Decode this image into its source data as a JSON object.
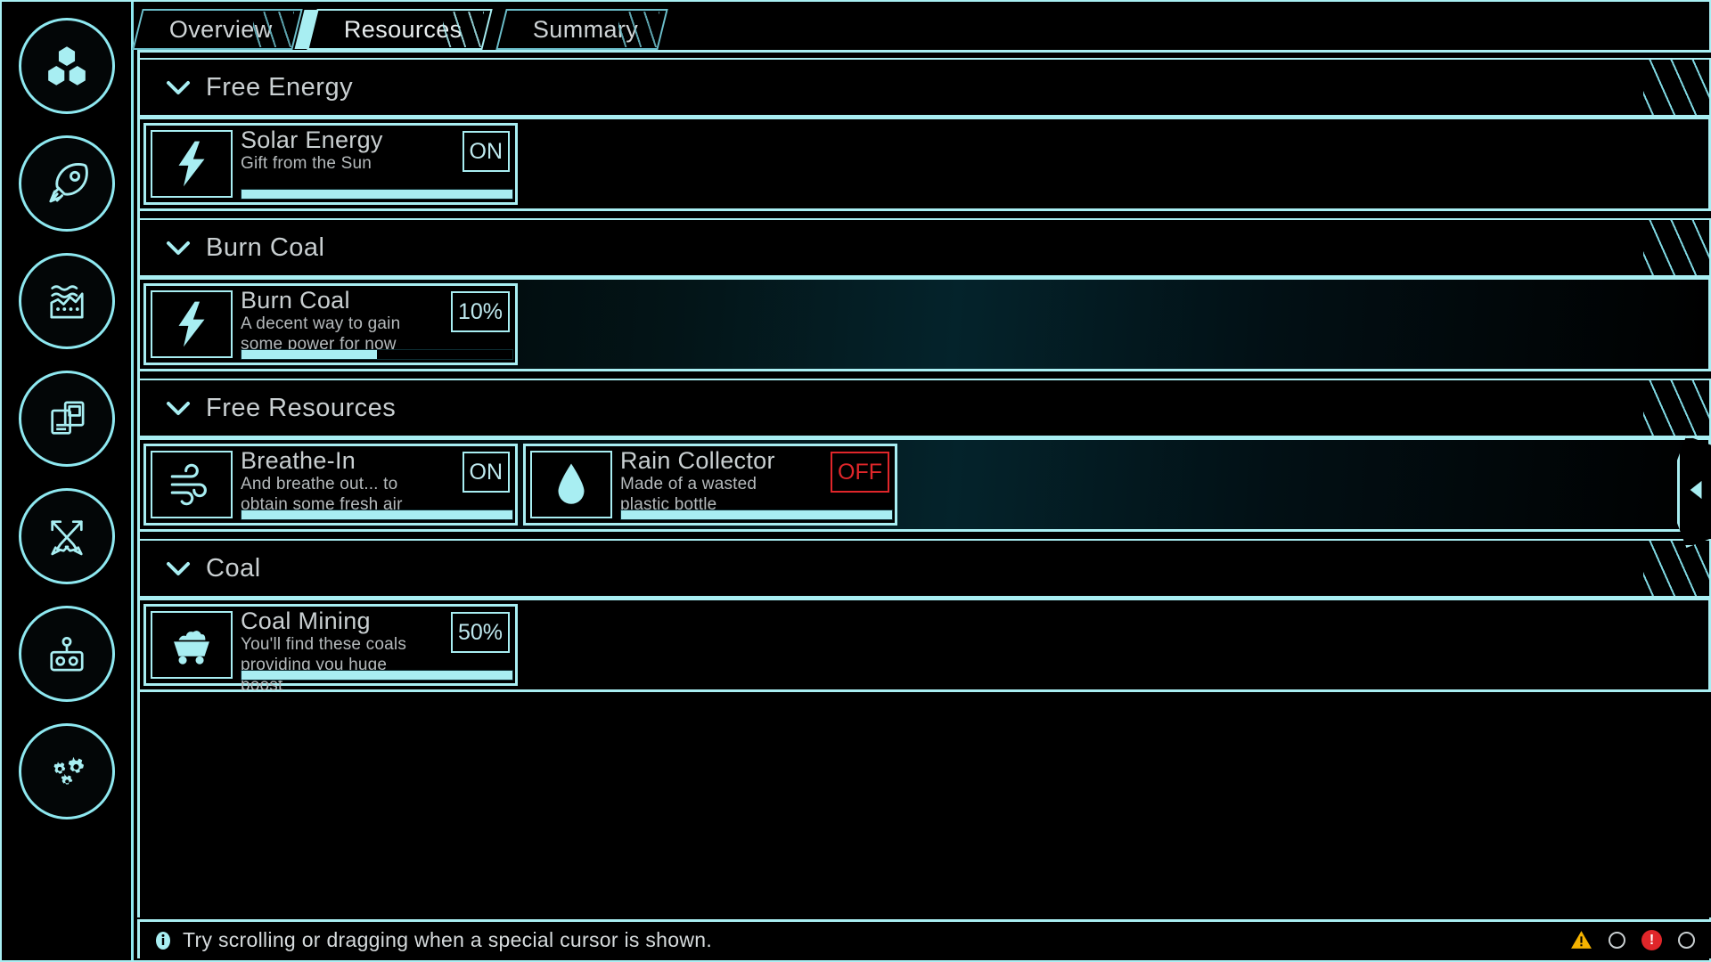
{
  "sidebar": {
    "items": [
      {
        "label": "Resources",
        "icon": "hex-cluster-icon"
      },
      {
        "label": "Rocket",
        "icon": "rocket-icon"
      },
      {
        "label": "Factory",
        "icon": "factory-icon"
      },
      {
        "label": "Cards",
        "icon": "cards-icon"
      },
      {
        "label": "Combat",
        "icon": "crossed-swords-icon"
      },
      {
        "label": "Robot",
        "icon": "robot-icon"
      },
      {
        "label": "Settings",
        "icon": "gears-icon"
      }
    ]
  },
  "tabs": [
    {
      "label": "Overview",
      "active": false
    },
    {
      "label": "Resources",
      "active": true
    },
    {
      "label": "Summary",
      "active": false
    }
  ],
  "sections": [
    {
      "title": "Free Energy",
      "chevron": "chevron-down-icon",
      "highlight": false,
      "cards": [
        {
          "name": "Solar Energy",
          "desc": "Gift from the Sun",
          "icon": "lightning-bolt-icon",
          "badge": "ON",
          "badge_state": "on",
          "progress": 100
        }
      ]
    },
    {
      "title": "Burn Coal",
      "chevron": "chevron-down-icon",
      "highlight": true,
      "cards": [
        {
          "name": "Burn Coal",
          "desc": "A decent way to gain some power for now",
          "icon": "lightning-bolt-icon",
          "badge": "10%",
          "badge_state": "on",
          "progress": 50
        }
      ]
    },
    {
      "title": "Free Resources",
      "chevron": "chevron-down-icon",
      "highlight": true,
      "cards": [
        {
          "name": "Breathe-In",
          "desc": "And breathe out... to obtain some fresh air",
          "icon": "wind-icon",
          "badge": "ON",
          "badge_state": "on",
          "progress": 100
        },
        {
          "name": "Rain Collector",
          "desc": "Made of a wasted plastic bottle",
          "icon": "water-drop-icon",
          "badge": "OFF",
          "badge_state": "off",
          "progress": 100
        }
      ]
    },
    {
      "title": "Coal",
      "chevron": "chevron-down-icon",
      "highlight": false,
      "cards": [
        {
          "name": "Coal Mining",
          "desc": "You'll find these coals providing you huge boost",
          "icon": "mine-cart-icon",
          "badge": "50%",
          "badge_state": "on",
          "progress": 100
        }
      ]
    }
  ],
  "side_arrow": {
    "icon": "chevron-left-icon"
  },
  "statusbar": {
    "info_icon": "info-icon",
    "text": "Try scrolling or dragging when a special cursor is shown.",
    "indicators": [
      {
        "name": "warning",
        "icon": "warning-triangle-icon"
      },
      {
        "name": "circle-1",
        "icon": "circle-outline-icon"
      },
      {
        "name": "error",
        "icon": "error-circle-icon"
      },
      {
        "name": "circle-2",
        "icon": "circle-outline-icon"
      }
    ]
  },
  "colors": {
    "accent": "#a8eef2",
    "accent_dim": "#6cbfcb",
    "text": "#c9cfd1",
    "danger": "#e0262a",
    "warning": "#f5b300",
    "bg": "#000000"
  }
}
